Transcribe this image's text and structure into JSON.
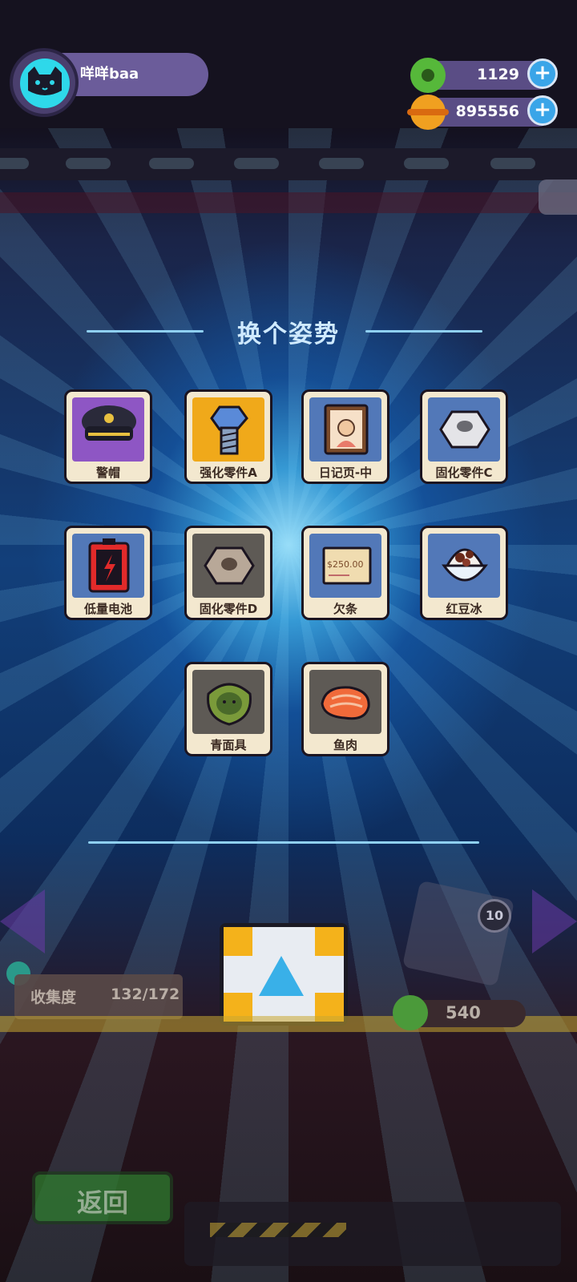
{
  "player": {
    "name": "咩咩baa",
    "avatar_icon": "cat-face-icon"
  },
  "currencies": [
    {
      "name": "donut",
      "icon": "green-donut-icon",
      "value": "1129",
      "color": "#56b83a"
    },
    {
      "name": "coin",
      "icon": "orange-planet-icon",
      "value": "895556",
      "color": "#f0a020"
    }
  ],
  "panel": {
    "title": "换个姿势",
    "items": [
      {
        "label": "警帽",
        "icon": "police-cap-icon",
        "bg": "purple"
      },
      {
        "label": "强化零件A",
        "icon": "bolt-icon",
        "bg": "orange"
      },
      {
        "label": "日记页-中",
        "icon": "diary-page-icon",
        "bg": "blue"
      },
      {
        "label": "固化零件C",
        "icon": "hex-nut-icon",
        "bg": "blue"
      },
      {
        "label": "低量电池",
        "icon": "low-battery-icon",
        "bg": "blue"
      },
      {
        "label": "固化零件D",
        "icon": "hex-nut-icon",
        "bg": "gray"
      },
      {
        "label": "欠条",
        "icon": "iou-note-icon",
        "bg": "blue"
      },
      {
        "label": "红豆冰",
        "icon": "red-bean-ice-icon",
        "bg": "blue"
      },
      {
        "label": "青面具",
        "icon": "green-mask-icon",
        "bg": "gray"
      },
      {
        "label": "鱼肉",
        "icon": "fish-meat-icon",
        "bg": "gray"
      }
    ],
    "note_text": "$250.00"
  },
  "bottom": {
    "collection_label": "收集度",
    "collection_value": "132/172",
    "draw_cost": "540",
    "side_badge": "10",
    "back_label": "返回"
  }
}
